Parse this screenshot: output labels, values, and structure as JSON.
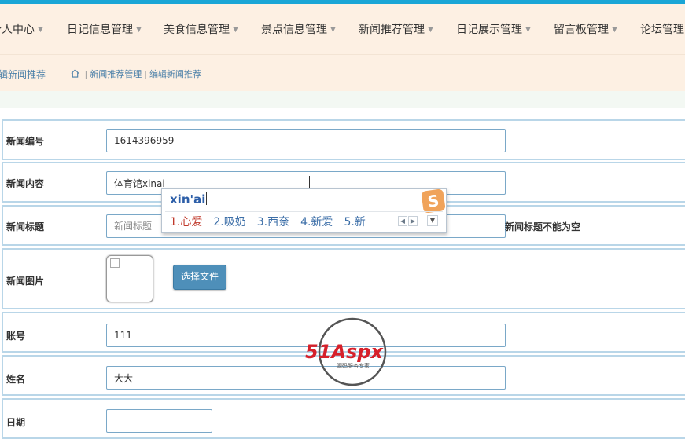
{
  "nav": {
    "items": [
      {
        "label": "个人中心"
      },
      {
        "label": "日记信息管理"
      },
      {
        "label": "美食信息管理"
      },
      {
        "label": "景点信息管理"
      },
      {
        "label": "新闻推荐管理"
      },
      {
        "label": "日记展示管理"
      },
      {
        "label": "留言板管理"
      },
      {
        "label": "论坛管理"
      }
    ]
  },
  "header": {
    "page_title": "编辑新闻推荐",
    "breadcrumb": [
      "新闻推荐管理",
      "编辑新闻推荐"
    ]
  },
  "form": {
    "news_id": {
      "label": "新闻编号",
      "value": "1614396959"
    },
    "news_content": {
      "label": "新闻内容",
      "value": "体育馆xinai"
    },
    "news_title": {
      "label": "新闻标题",
      "placeholder": "新闻标题",
      "hint": "新闻标题不能为空"
    },
    "news_image": {
      "label": "新闻图片",
      "button": "选择文件"
    },
    "account": {
      "label": "账号",
      "value": "111"
    },
    "name": {
      "label": "姓名",
      "value": "大大"
    },
    "date": {
      "label": "日期",
      "value": ""
    }
  },
  "ime": {
    "composition": "xin'ai",
    "candidates": [
      "1.心爱",
      "2.吸奶",
      "3.西奈",
      "4.新爱",
      "5.新"
    ],
    "logo_glyph": "S"
  },
  "watermark": {
    "brand": "51Aspx",
    "tagline": "源码服务专家"
  },
  "colors": {
    "accent": "#1ba6d6",
    "nav_bg": "#fdf0e3",
    "button": "#4e8fb9",
    "field_border": "#7aa8c8"
  }
}
